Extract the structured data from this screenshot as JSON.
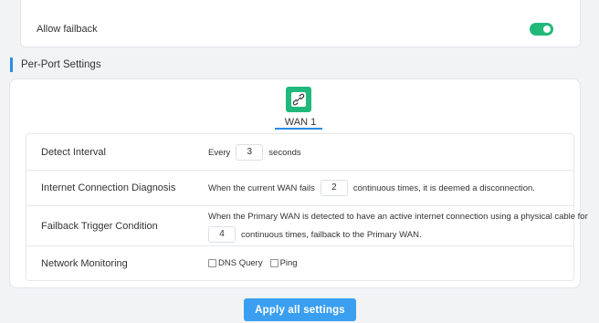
{
  "failback": {
    "label": "Allow failback",
    "enabled": true
  },
  "section": {
    "title": "Per-Port Settings"
  },
  "ports": [
    {
      "label": "WAN 1",
      "active": true
    }
  ],
  "rows": {
    "detect": {
      "label": "Detect Interval",
      "prefix": "Every",
      "value": "3",
      "suffix": "seconds"
    },
    "diagnosis": {
      "label": "Internet Connection Diagnosis",
      "prefix": "When the current WAN fails",
      "value": "2",
      "suffix": "continuous times, it is deemed a disconnection."
    },
    "failback": {
      "label": "Failback Trigger Condition",
      "line1": "When the Primary WAN is detected to have an active internet connection using a physical cable for",
      "value": "4",
      "suffix": "continuous times, failback to the Primary WAN."
    },
    "monitoring": {
      "label": "Network Monitoring",
      "options": [
        {
          "label": "DNS Query",
          "checked": false
        },
        {
          "label": "Ping",
          "checked": false
        }
      ]
    }
  },
  "apply": {
    "label": "Apply all settings"
  },
  "colors": {
    "accent": "#2a8de6",
    "toggle_on": "#21b97b",
    "button": "#3a9ff0"
  }
}
